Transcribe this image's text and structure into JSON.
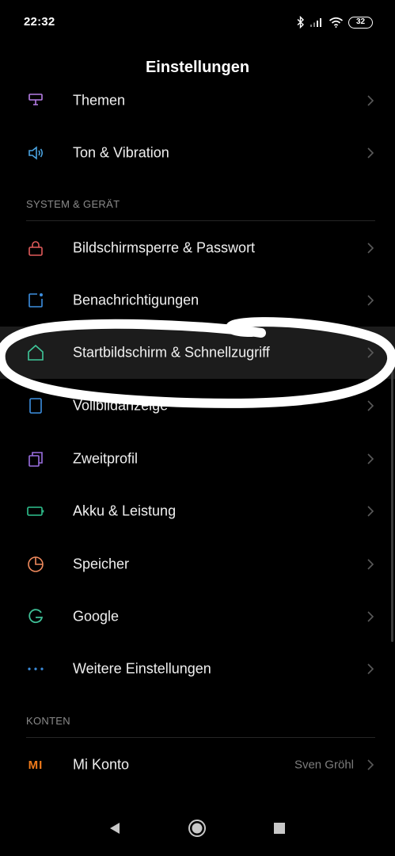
{
  "status_bar": {
    "time": "22:32",
    "battery": "32",
    "icons": [
      "bluetooth-icon",
      "signal-icon",
      "wifi-icon",
      "battery-icon"
    ]
  },
  "header": {
    "title": "Einstellungen"
  },
  "rows": {
    "themen": {
      "label": "Themen",
      "icon": "theme-brush-icon",
      "color": "#b67ee6"
    },
    "ton": {
      "label": "Ton & Vibration",
      "icon": "speaker-icon",
      "color": "#4aa3e0"
    },
    "bildschirmsperre": {
      "label": "Bildschirmsperre & Passwort",
      "icon": "lock-icon",
      "color": "#e25b5b"
    },
    "benachrichtigungen": {
      "label": "Benachrichtigungen",
      "icon": "notification-icon",
      "color": "#3d8fe0"
    },
    "startbildschirm": {
      "label": "Startbildschirm & Schnellzugriff",
      "icon": "home-icon",
      "color": "#3fc79a"
    },
    "vollbild": {
      "label": "Vollbildanzeige",
      "icon": "fullscreen-icon",
      "color": "#3d8fe0"
    },
    "zweitprofil": {
      "label": "Zweitprofil",
      "icon": "dual-profile-icon",
      "color": "#9a6fe0"
    },
    "akku": {
      "label": "Akku & Leistung",
      "icon": "battery-icon",
      "color": "#2fc28f"
    },
    "speicher": {
      "label": "Speicher",
      "icon": "storage-pie-icon",
      "color": "#f08a5d"
    },
    "google": {
      "label": "Google",
      "icon": "google-icon",
      "color": "#3fbf96"
    },
    "weitere": {
      "label": "Weitere Einstellungen",
      "icon": "more-dots-icon",
      "color": "#3d8fe0"
    },
    "mi_konto": {
      "label": "Mi Konto",
      "icon": "mi-logo-icon",
      "color": "#f07a1a",
      "value": "Sven Gröhl"
    }
  },
  "sections": {
    "system": "SYSTEM & GERÄT",
    "konten": "KONTEN"
  },
  "mi_logo_text": "MI",
  "navigation": [
    "back-icon",
    "home-icon",
    "recents-icon"
  ]
}
